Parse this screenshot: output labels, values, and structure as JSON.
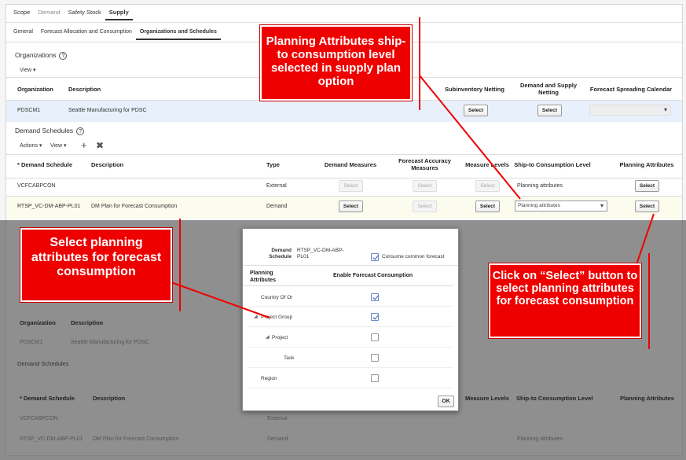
{
  "top_tabs": [
    "Scope",
    "Demand",
    "Safety Stock",
    "Supply"
  ],
  "sub_tabs": [
    "General",
    "Forecast Allocation and Consumption",
    "Organizations and Schedules"
  ],
  "organizations": {
    "title": "Organizations",
    "view": "View",
    "headers": [
      "Organization",
      "Description",
      "Subinventory Netting",
      "Demand and Supply Netting",
      "Forecast Spreading Calendar"
    ],
    "row": {
      "org": "PDSCM1",
      "desc": "Seattle Manufacturing for PDSC",
      "btn1": "Select",
      "btn2": "Select"
    }
  },
  "demand_schedules": {
    "title": "Demand Schedules",
    "actions": "Actions",
    "view": "View",
    "headers": [
      "* Demand Schedule",
      "Description",
      "Type",
      "Demand Measures",
      "Forecast Accuracy Measures",
      "Measure Levels",
      "Ship-to Consumption Level",
      "Planning Attributes"
    ],
    "rows": [
      {
        "name": "VCFCABPCON",
        "desc": "",
        "type": "External",
        "dm": "Select",
        "fam": "Select",
        "ml": "Select",
        "ship": "Planning attributes",
        "pa": "Select"
      },
      {
        "name": "RTSP_VC-DM-ABP-PL01",
        "desc": "DM Plan for Forecast Consumption",
        "type": "Demand",
        "dm": "Select",
        "fam": "Select",
        "ml": "Select",
        "ship": "Planning attributes",
        "pa": "Select"
      }
    ]
  },
  "dialog": {
    "schedule_label": "Demand Schedule",
    "schedule_value": "RTSP_VC-DM-ABP-PL01",
    "consume_label": "Consume common forecast",
    "col1": "Planning Attributes",
    "col2": "Enable Forecast Consumption",
    "tree": [
      {
        "label": "Country Of Or",
        "checked": true
      },
      {
        "label": "Project Group",
        "checked": true
      },
      {
        "label": "Project",
        "checked": false
      },
      {
        "label": "Task",
        "checked": false
      },
      {
        "label": "Region",
        "checked": false
      }
    ],
    "ok": "OK"
  },
  "callouts": {
    "top": "Planning Attributes ship-to consumption level selected in supply plan option",
    "left": "Select planning attributes for forecast consumption",
    "right": "Click on “Select” button to select planning attributes for forecast consumption"
  },
  "colors": {
    "callout": "#ee0000",
    "highlight": "#e8f1fb"
  }
}
